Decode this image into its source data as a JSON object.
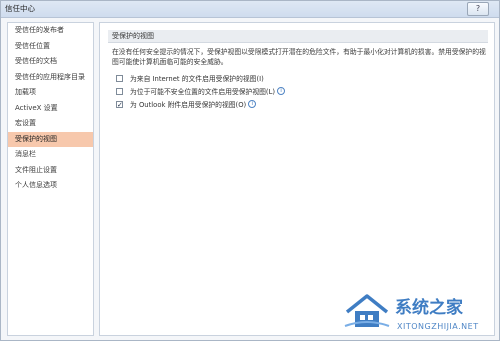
{
  "window": {
    "title": "信任中心",
    "help_label": "?"
  },
  "sidebar": {
    "items": [
      {
        "label": "受信任的发布者"
      },
      {
        "label": "受信任位置"
      },
      {
        "label": "受信任的文档"
      },
      {
        "label": "受信任的应用程序目录"
      },
      {
        "label": "加载项"
      },
      {
        "label": "ActiveX 设置"
      },
      {
        "label": "宏设置"
      },
      {
        "label": "受保护的视图",
        "selected": true
      },
      {
        "label": "消息栏"
      },
      {
        "label": "文件阻止设置"
      },
      {
        "label": "个人信息选项"
      }
    ]
  },
  "main": {
    "section_title": "受保护的视图",
    "description": "在没有任何安全提示的情况下，受保护视图以受限模式打开潜在的危险文件，有助于最小化对计算机的损害。禁用受保护的视图可能使计算机面临可能的安全威胁。",
    "options": [
      {
        "label": "为来自 Internet 的文件启用受保护的视图(I)",
        "checked": false,
        "info_icon": false
      },
      {
        "label": "为位于可能不安全位置的文件启用受保护视图(L)",
        "checked": false,
        "info_icon": true
      },
      {
        "label": "为 Outlook 附件启用受保护的视图(O)",
        "checked": true,
        "info_icon": true
      }
    ]
  },
  "watermark": {
    "text": "系统之家",
    "url": "XITONGZHIJIA.NET"
  },
  "colors": {
    "selected_nav": "#f7c8ac",
    "section_header": "#eaedf1",
    "watermark_blue": "#3f7dc3"
  }
}
